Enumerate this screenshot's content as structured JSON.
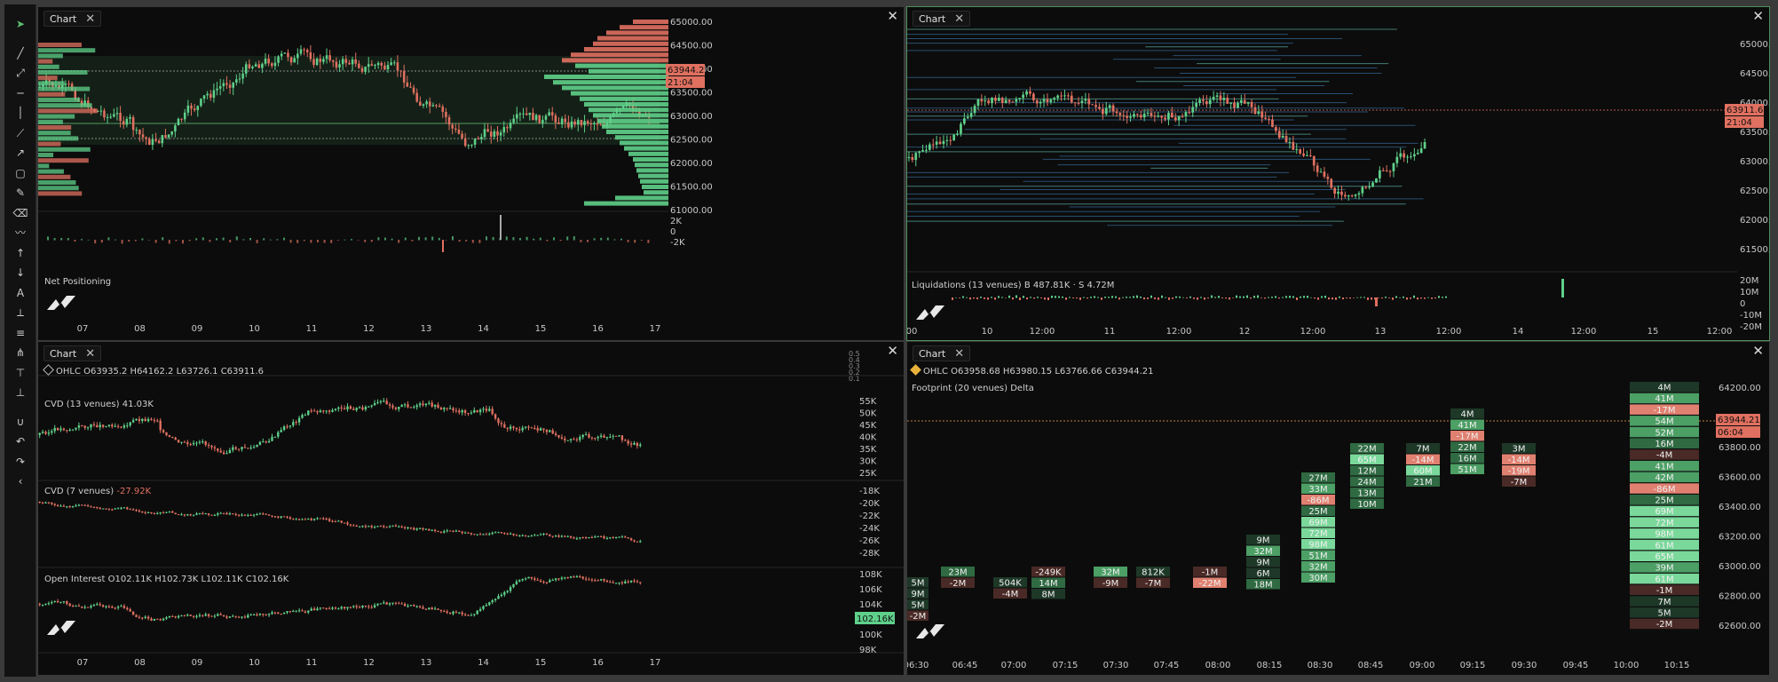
{
  "toolbar": {
    "tools": [
      "cursor-icon",
      "trend-line-icon",
      "ray-icon",
      "horizontal-line-icon",
      "vertical-line-icon",
      "extended-line-icon",
      "arrow-line-icon",
      "rectangle-icon",
      "brush-icon",
      "eraser-icon",
      "path-icon",
      "arrow-up-icon",
      "arrow-down-icon",
      "text-icon",
      "measure-icon",
      "fib-icon",
      "pitchfork-icon",
      "long-position-icon",
      "short-position-icon",
      "magnet-icon",
      "undo-icon",
      "redo-icon",
      "collapse-icon"
    ]
  },
  "panels": {
    "tl": {
      "tab": "Chart",
      "sub_label": "Net Positioning",
      "price_ticks": [
        "65000.00",
        "64500.00",
        "64000.00",
        "63500.00",
        "63000.00",
        "62500.00",
        "62000.00",
        "61500.00",
        "61000.00"
      ],
      "last_price": "63944.21",
      "timer": "21:04",
      "sub_ticks": [
        "2K",
        "0",
        "-2K"
      ],
      "time_ticks": [
        "07",
        "08",
        "09",
        "10",
        "11",
        "12",
        "13",
        "14",
        "15",
        "16",
        "17"
      ]
    },
    "tr": {
      "tab": "Chart",
      "sub_label": "Liquidations (13 venues)",
      "sub_values": "B 487.81K · S 4.72M",
      "price_ticks": [
        "65000.0",
        "64500.0",
        "64000.0",
        "63500.0",
        "63000.0",
        "62500.0",
        "62000.0",
        "61500.0"
      ],
      "last_price": "63911.6",
      "timer": "21:04",
      "sub_ticks": [
        "20M",
        "10M",
        "0",
        "-10M",
        "-20M"
      ],
      "time_ticks": [
        "00",
        "10",
        "12:00",
        "11",
        "12:00",
        "12",
        "12:00",
        "13",
        "12:00",
        "14",
        "12:00",
        "15",
        "12:00"
      ]
    },
    "bl": {
      "tab": "Chart",
      "ohlc_label": "OHLC",
      "ohlc_values": "O63935.2 H64162.2 L63726.1 C63911.6",
      "cvd1_label": "CVD (13 venues)",
      "cvd1_value": "41.03K",
      "cvd1_ticks": [
        "55K",
        "50K",
        "45K",
        "40K",
        "35K",
        "30K",
        "25K"
      ],
      "cvd2_label": "CVD (7 venues)",
      "cvd2_value": "-27.92K",
      "cvd2_ticks": [
        "-18K",
        "-20K",
        "-22K",
        "-24K",
        "-26K",
        "-28K"
      ],
      "oi_label": "Open Interest",
      "oi_values": "O102.11K H102.73K L102.11K C102.16K",
      "oi_ticks": [
        "108K",
        "106K",
        "104K",
        "102K",
        "100K",
        "98K"
      ],
      "oi_last": "102.16K",
      "top_ticks": [
        "0.5",
        "0.4",
        "0.3",
        "0.2",
        "0.1"
      ],
      "time_ticks": [
        "07",
        "08",
        "09",
        "10",
        "11",
        "12",
        "13",
        "14",
        "15",
        "16",
        "17"
      ]
    },
    "br": {
      "tab": "Chart",
      "ohlc_label": "OHLC",
      "ohlc_values": "O63958.68 H63980.15 L63766.66 C63944.21",
      "footprint_label": "Footprint (20 venues)",
      "footprint_mode": "Delta",
      "price_ticks": [
        "64200.00",
        "64000.00",
        "63800.00",
        "63600.00",
        "63400.00",
        "63200.00",
        "63000.00",
        "62800.00",
        "62600.00"
      ],
      "last_price": "63944.21",
      "timer": "06:04",
      "time_ticks": [
        "06:30",
        "06:45",
        "07:00",
        "07:15",
        "07:30",
        "07:45",
        "08:00",
        "08:15",
        "08:30",
        "08:45",
        "09:00",
        "09:15",
        "09:30",
        "09:45",
        "10:00",
        "10:15"
      ],
      "profile_values": [
        "4M",
        "41M",
        "-17M",
        "54M",
        "52M",
        "16M",
        "-4M",
        "41M",
        "42M",
        "-86M",
        "25M",
        "69M",
        "72M",
        "98M",
        "61M",
        "65M",
        "39M",
        "61M",
        "-1M",
        "7M",
        "5M",
        "-2M"
      ],
      "fp_columns": [
        {
          "cells": [
            "5M",
            "9M",
            "5M",
            "-2M"
          ]
        },
        {
          "cells": [
            "23M",
            "-2M"
          ]
        },
        {
          "cells": [
            "504K",
            "-4M"
          ]
        },
        {
          "cells": [
            "-249K",
            "14M",
            "8M"
          ]
        },
        {
          "cells": [
            "32M",
            "-9M"
          ]
        },
        {
          "cells": [
            "812K",
            "-7M"
          ]
        },
        {
          "cells": [
            "-1M",
            "-22M"
          ]
        },
        {
          "cells": [
            "9M",
            "32M",
            "9M",
            "6M",
            "18M"
          ]
        },
        {
          "cells": [
            "27M",
            "33M",
            "-86M",
            "25M",
            "69M",
            "72M",
            "98M",
            "51M",
            "32M",
            "30M"
          ]
        },
        {
          "cells": [
            "22M",
            "65M",
            "12M",
            "24M",
            "13M",
            "10M"
          ]
        },
        {
          "cells": [
            "7M",
            "-14M",
            "60M",
            "21M"
          ]
        },
        {
          "cells": [
            "4M",
            "41M",
            "-17M",
            "22M",
            "16M",
            "51M"
          ]
        },
        {
          "cells": [
            "3M",
            "-14M",
            "-19M",
            "-7M"
          ]
        }
      ]
    }
  },
  "colors": {
    "up": "#5fd08a",
    "down": "#e07060",
    "bg": "#0c0c0c",
    "accent": "#4e8f5a"
  }
}
